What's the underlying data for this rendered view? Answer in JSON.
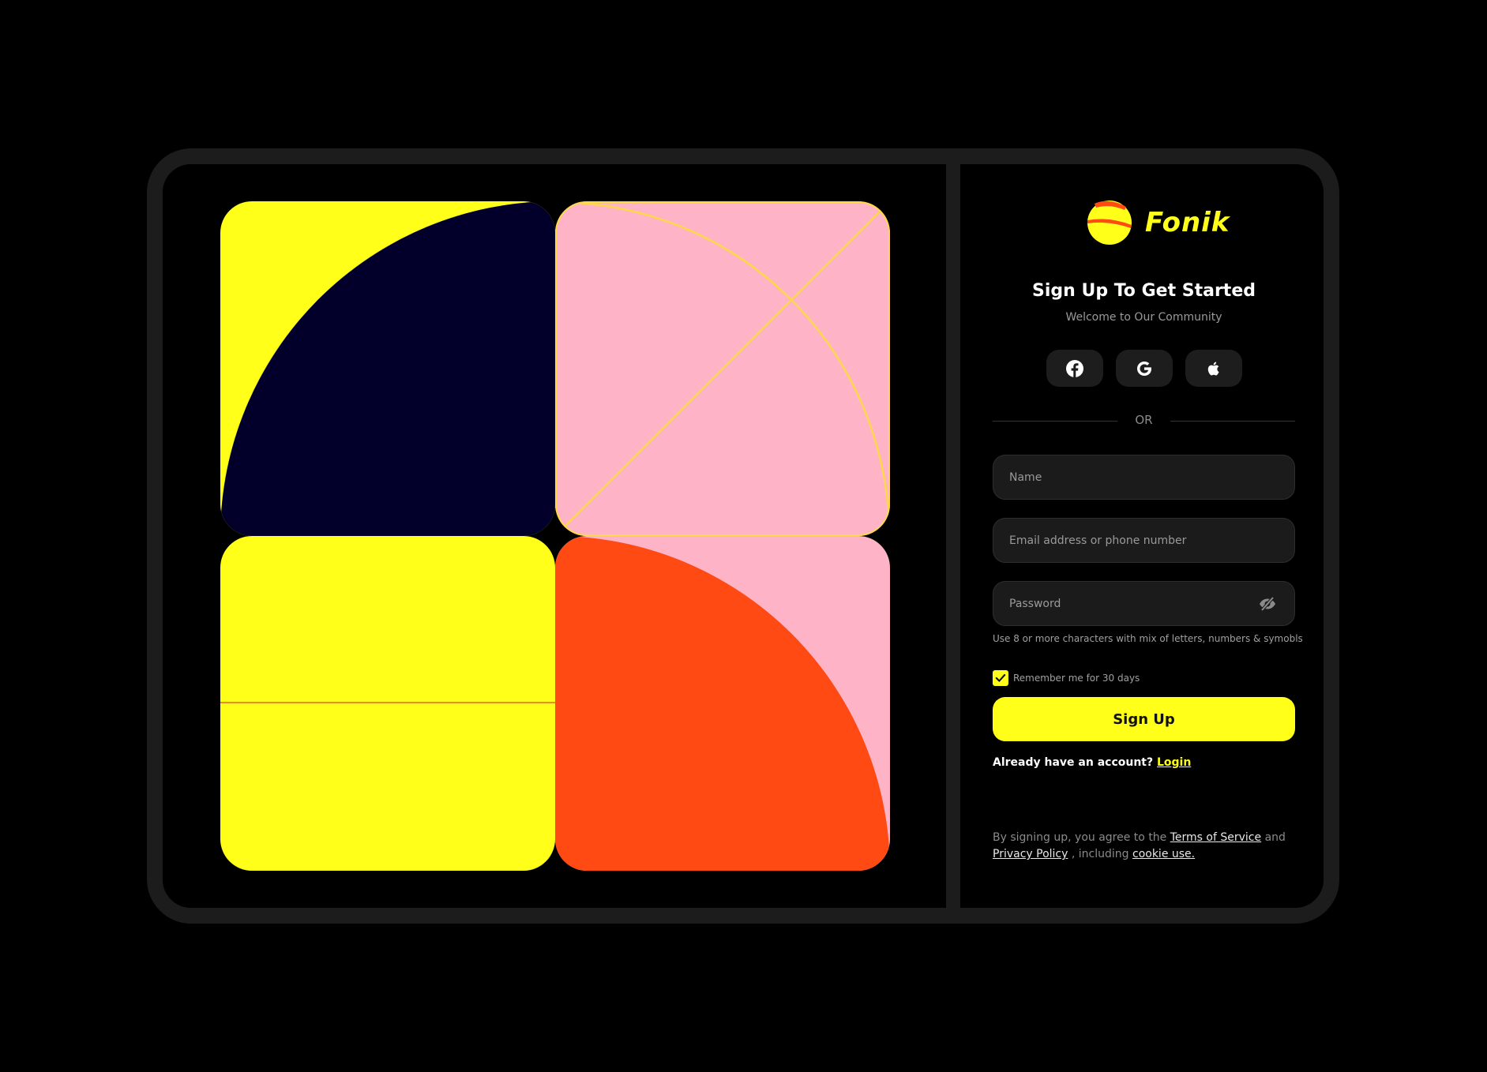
{
  "brand": {
    "name": "Fonik",
    "colors": {
      "accent": "#ffff1a",
      "accent_stripe": "#ff4a14"
    }
  },
  "header": {
    "title": "Sign Up To Get Started",
    "subtitle": "Welcome to Our Community"
  },
  "social_login": [
    {
      "provider": "Facebook",
      "icon": "facebook-icon"
    },
    {
      "provider": "Google",
      "icon": "google-icon"
    },
    {
      "provider": "Apple",
      "icon": "apple-icon"
    }
  ],
  "divider_text": "OR",
  "form": {
    "name": {
      "placeholder": "Name",
      "value": ""
    },
    "email": {
      "placeholder": "Email address or phone number",
      "value": ""
    },
    "password": {
      "placeholder": "Password",
      "value": "",
      "toggle_icon": "eye-off-icon"
    },
    "password_hint": "Use 8 or more characters with mix of letters, numbers & symobls",
    "remember": {
      "label": "Remember me for 30 days",
      "checked": true
    },
    "submit_label": "Sign Up"
  },
  "login_prompt": {
    "text": "Already have an account?",
    "link": "Login"
  },
  "legal": {
    "prefix": "By signing up, you agree to the",
    "terms": "Terms of Service",
    "and": "and",
    "privacy": "Privacy Policy",
    "including": ", including",
    "cookie": "cookie use."
  },
  "art": {
    "colors": {
      "yellow": "#ffff1a",
      "navy": "#02002a",
      "pink": "#ffb3c7",
      "orange": "#ff4a14",
      "gold_line": "#ffd84a",
      "orange_line": "#f08a1a"
    }
  }
}
